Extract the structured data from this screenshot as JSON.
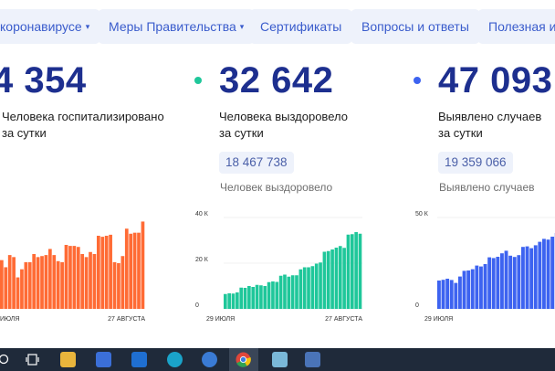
{
  "nav": {
    "tabs": [
      {
        "label": "коронавирусе",
        "dropdown": true
      },
      {
        "label": "Меры Правительства",
        "dropdown": true
      },
      {
        "label": "Сертификаты",
        "dropdown": false
      },
      {
        "label": "Вопросы и ответы",
        "dropdown": false
      },
      {
        "label": "Полезная ин",
        "dropdown": false
      }
    ],
    "caret": "▾"
  },
  "stats": {
    "hospitalized": {
      "value": "4 354",
      "desc_line1": "Человека госпитализировано",
      "desc_line2": "за сутки",
      "color": "#ff6b35"
    },
    "recovered": {
      "value": "32 642",
      "desc_line1": "Человека выздоровело",
      "desc_line2": "за сутки",
      "total": "18 467 738",
      "total_label": "Человек выздоровело",
      "color": "#1fc79a"
    },
    "cases": {
      "value": "47 093",
      "desc_line1": "Выявлено случаев",
      "desc_line2": "за сутки",
      "total": "19 359 066",
      "total_label": "Выявлено случаев",
      "color": "#3d63f0"
    }
  },
  "chart_data": [
    {
      "type": "bar",
      "title": "",
      "xlabel": "",
      "ylabel": "",
      "x_start": "ИЮЛЯ",
      "x_end": "27 АВГУСТА",
      "values": [
        2400,
        2050,
        2650,
        2550,
        1550,
        1950,
        2300,
        2300,
        2700,
        2550,
        2600,
        2650,
        2950,
        2650,
        2350,
        2300,
        3150,
        3100,
        3100,
        3050,
        2700,
        2550,
        2800,
        2700,
        3600,
        3550,
        3600,
        3650,
        2300,
        2250,
        2600,
        3950,
        3700,
        3750,
        3750,
        4300
      ]
    },
    {
      "type": "bar",
      "title": "",
      "xlabel": "",
      "ylabel": "",
      "y_ticks": [
        "40 К",
        "20 К",
        "0"
      ],
      "ylim": [
        0,
        40000
      ],
      "x_start": "29 ИЮЛЯ",
      "x_end": "27 АВГУСТА",
      "values": [
        6500,
        6800,
        6700,
        7200,
        9300,
        9200,
        10000,
        9600,
        10500,
        10300,
        10000,
        11700,
        12000,
        11800,
        14500,
        15000,
        14100,
        14700,
        14700,
        17300,
        18200,
        18200,
        18700,
        19800,
        20300,
        25000,
        25300,
        26000,
        26800,
        27500,
        26700,
        32500,
        32700,
        33600,
        32900
      ]
    },
    {
      "type": "bar",
      "title": "",
      "xlabel": "",
      "ylabel": "",
      "y_ticks": [
        "50 К",
        "0"
      ],
      "ylim": [
        0,
        50000
      ],
      "x_start": "29 ИЮЛЯ",
      "values": [
        15500,
        15900,
        16500,
        15800,
        14200,
        17700,
        20800,
        21000,
        21700,
        23700,
        23200,
        24500,
        28200,
        27800,
        28500,
        30400,
        31800,
        29100,
        28400,
        29400,
        33900,
        34200,
        33200,
        34800,
        36700,
        38300,
        37900,
        39500,
        41500,
        41500
      ]
    }
  ]
}
